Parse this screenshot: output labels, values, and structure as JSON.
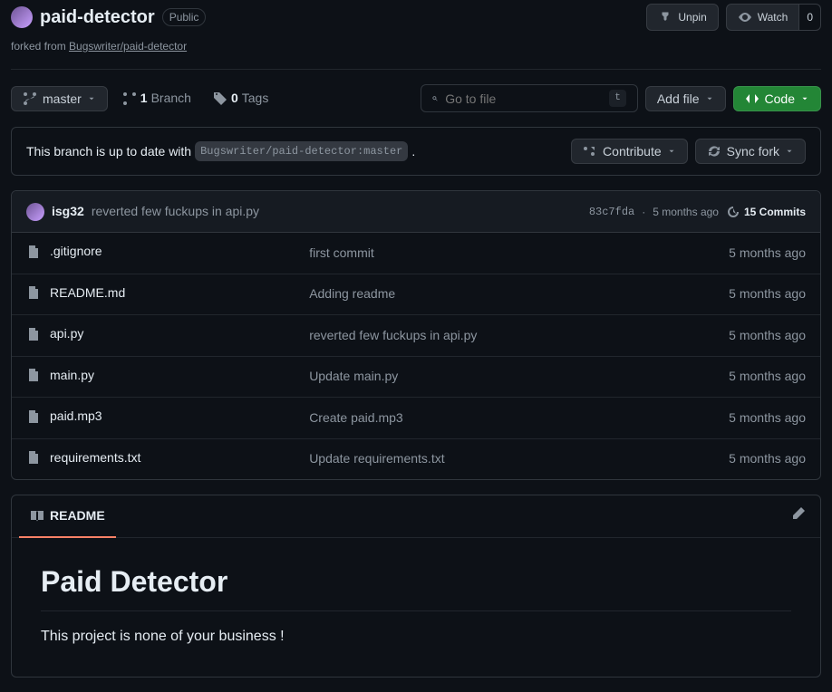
{
  "header": {
    "repo_name": "paid-detector",
    "visibility": "Public",
    "forked_prefix": "forked from ",
    "forked_link": "Bugswriter/paid-detector",
    "unpin_label": "Unpin",
    "watch_label": "Watch",
    "watch_count": "0"
  },
  "toolbar": {
    "branch": "master",
    "branches_count": "1",
    "branches_label": "Branch",
    "tags_count": "0",
    "tags_label": "Tags",
    "search_placeholder": "Go to file",
    "search_kbd": "t",
    "add_file_label": "Add file",
    "code_label": "Code"
  },
  "status": {
    "text_prefix": "This branch is up to date with",
    "upstream": "Bugswriter/paid-detector:master",
    "text_suffix": ".",
    "contribute_label": "Contribute",
    "sync_label": "Sync fork"
  },
  "commit": {
    "author": "isg32",
    "message": "reverted few fuckups in api.py",
    "sha": "83c7fda",
    "separator": "·",
    "time": "5 months ago",
    "total_label": "15 Commits"
  },
  "files": [
    {
      "name": ".gitignore",
      "message": "first commit",
      "time": "5 months ago"
    },
    {
      "name": "README.md",
      "message": "Adding readme",
      "time": "5 months ago"
    },
    {
      "name": "api.py",
      "message": "reverted few fuckups in api.py",
      "time": "5 months ago"
    },
    {
      "name": "main.py",
      "message": "Update main.py",
      "time": "5 months ago"
    },
    {
      "name": "paid.mp3",
      "message": "Create paid.mp3",
      "time": "5 months ago"
    },
    {
      "name": "requirements.txt",
      "message": "Update requirements.txt",
      "time": "5 months ago"
    }
  ],
  "readme": {
    "tab_label": "README",
    "title": "Paid Detector",
    "body": "This project is none of your business !"
  }
}
